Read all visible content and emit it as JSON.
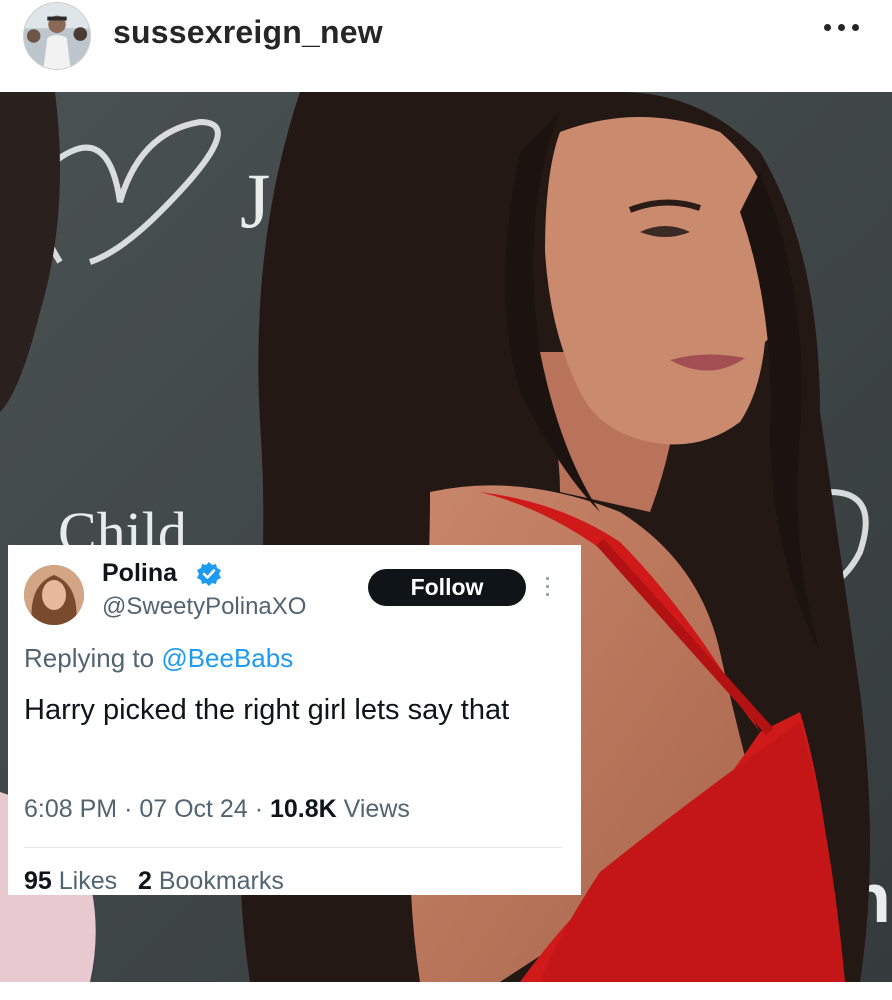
{
  "instagram": {
    "username": "sussexreign_new",
    "avatar_icon": "profile-avatar",
    "more_icon": "more-horizontal-icon"
  },
  "photo": {
    "backdrop_text": [
      "Jef",
      "Child",
      "hi"
    ],
    "dress_color": "#d01a1a",
    "backdrop_color": "#3f4546"
  },
  "tweet": {
    "display_name": "Polina",
    "verified_icon": "verified-badge-icon",
    "handle": "@SweetyPolinaXO",
    "follow_label": "Follow",
    "replying_prefix": "Replying to",
    "replying_handle": "@BeeBabs",
    "text": "Harry picked the right girl lets say that",
    "time": "6:08 PM",
    "date": "07 Oct 24",
    "views_count": "10.8K",
    "views_label": "Views",
    "likes_count": "95",
    "likes_label": "Likes",
    "bookmarks_count": "2",
    "bookmarks_label": "Bookmarks",
    "accent_color": "#1d9bf0"
  }
}
